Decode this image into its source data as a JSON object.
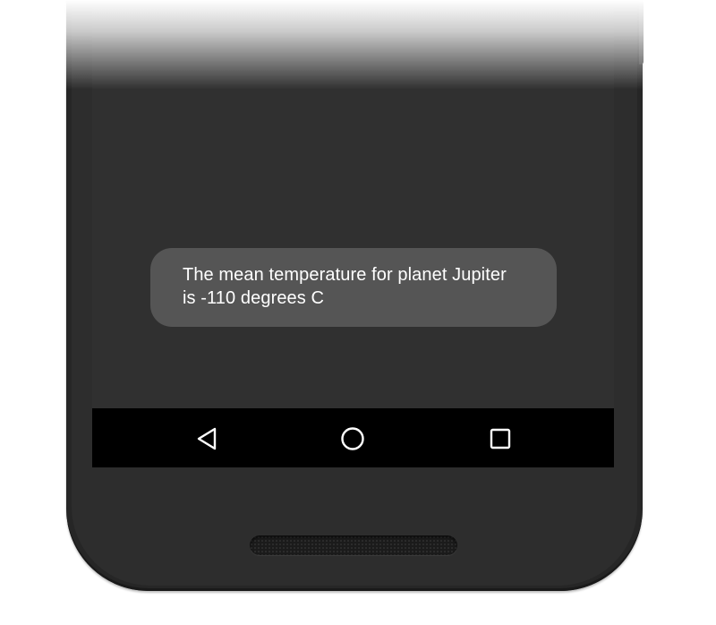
{
  "toast": {
    "line1": "The mean temperature for planet Jupiter",
    "line2": "is -110 degrees C"
  },
  "navbar": {
    "back_icon": "triangle-back-icon",
    "home_icon": "circle-home-icon",
    "recents_icon": "square-recents-icon"
  },
  "colors": {
    "screen_background": "#303030",
    "toast_background": "#555555",
    "toast_text": "#ffffff",
    "navbar_background": "#000000",
    "phone_body": "#262626"
  }
}
